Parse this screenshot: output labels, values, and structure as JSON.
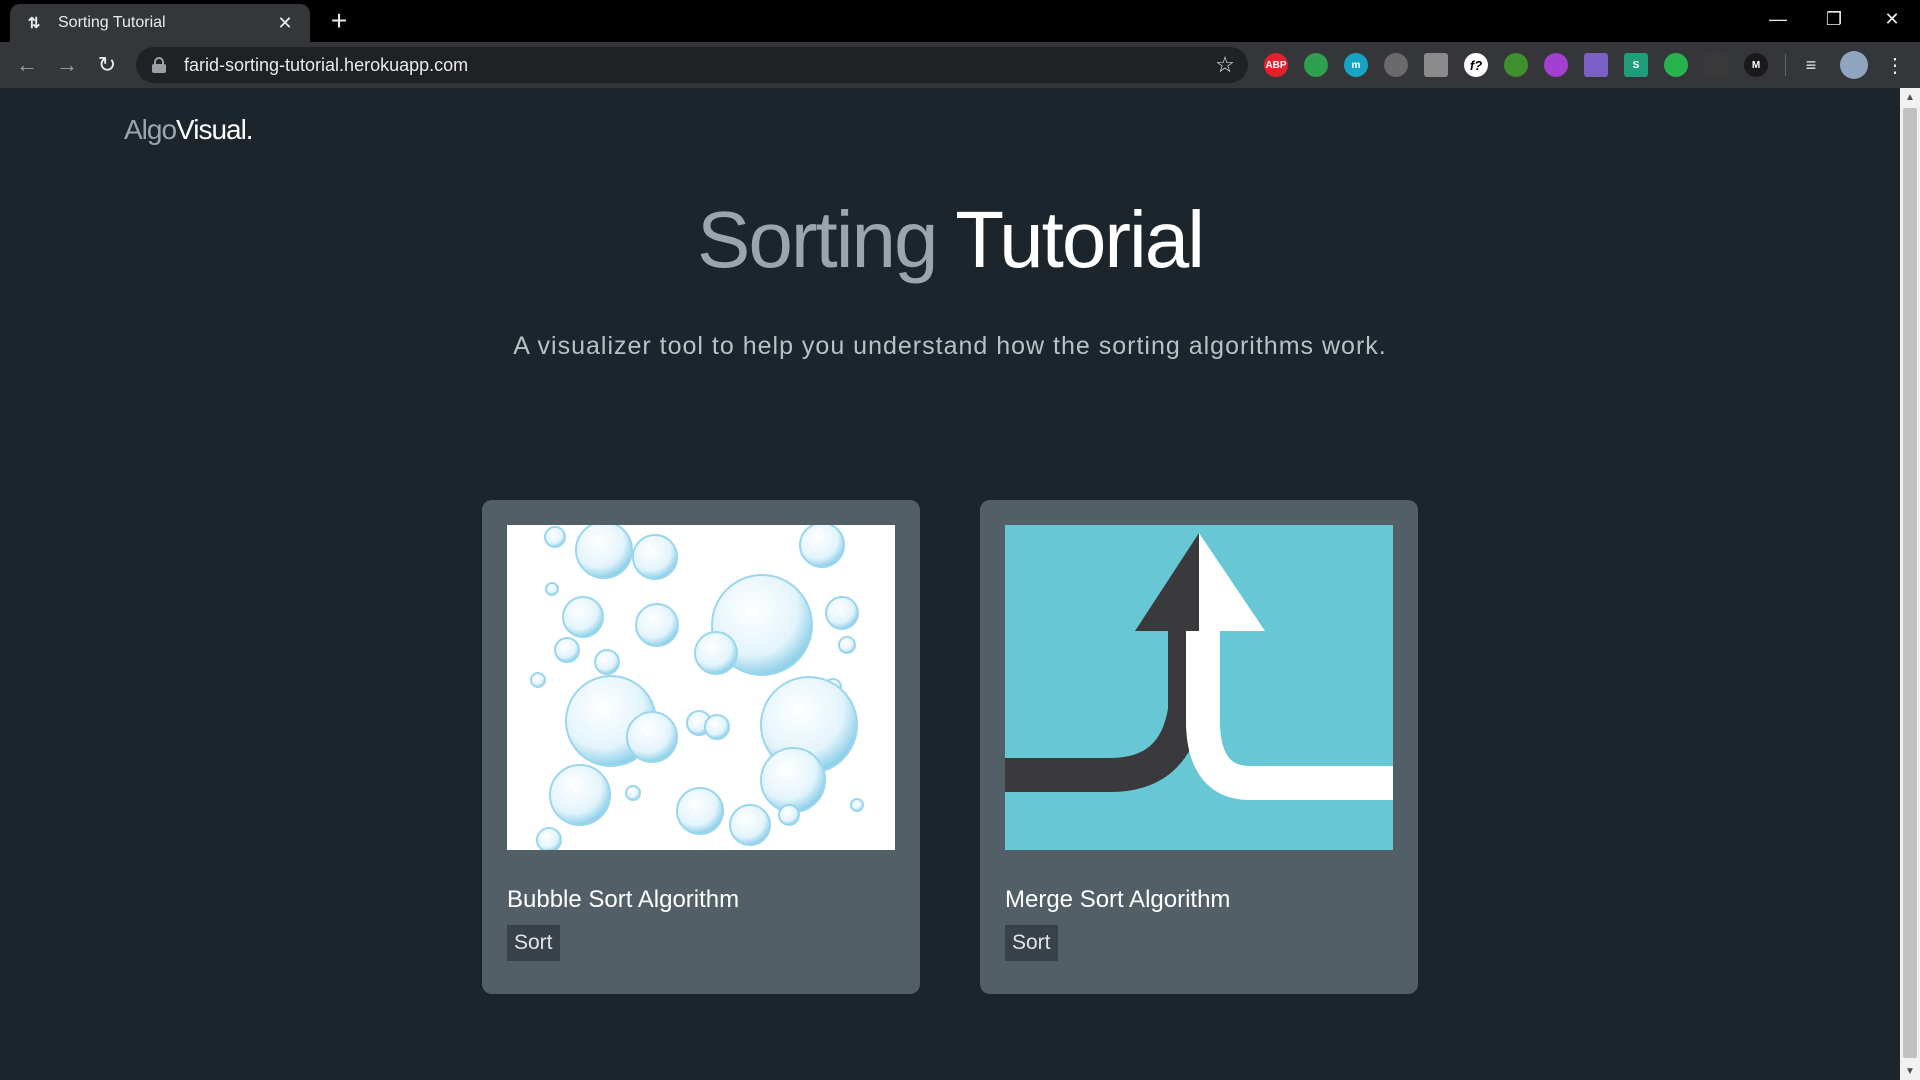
{
  "browser": {
    "tab_title": "Sorting Tutorial",
    "url": "farid-sorting-tutorial.herokuapp.com",
    "extensions": [
      {
        "name": "adblock-plus-extension",
        "label": "ABP",
        "color": "#e6202b"
      },
      {
        "name": "colorful-extension",
        "label": "",
        "color": "#2e9e4f"
      },
      {
        "name": "m-extension",
        "label": "m",
        "color": "#17a4c4"
      },
      {
        "name": "grey-extension",
        "label": "",
        "color": "#6a6a6a"
      },
      {
        "name": "pen-extension",
        "label": "",
        "color": "#8a8a8a"
      },
      {
        "name": "formula-extension",
        "label": "f?",
        "color": "#ffffff"
      },
      {
        "name": "tree-extension",
        "label": "",
        "color": "#3f8f2f"
      },
      {
        "name": "purple-extension",
        "label": "",
        "color": "#a23fd1"
      },
      {
        "name": "pdf-extension",
        "label": "",
        "color": "#7a5fc4"
      },
      {
        "name": "s-extension",
        "label": "S",
        "color": "#1f9c7a"
      },
      {
        "name": "green-m-extension",
        "label": "",
        "color": "#27b34d"
      },
      {
        "name": "grid-extension",
        "label": "",
        "color": "#3a3a3a"
      },
      {
        "name": "dark-extension",
        "label": "M",
        "color": "#1a1a1a"
      }
    ]
  },
  "site": {
    "logo_part1": "Algo",
    "logo_part2": "Visual."
  },
  "hero": {
    "title_part1": "Sorting",
    "title_part2": " Tutorial",
    "subtitle": "A visualizer tool to help you understand how the sorting algorithms work."
  },
  "cards": [
    {
      "title": "Bubble Sort Algorithm",
      "button": "Sort"
    },
    {
      "title": "Merge Sort Algorithm",
      "button": "Sort"
    }
  ],
  "colors": {
    "page_bg": "#1c252b",
    "card_bg": "#535f67",
    "merge_bg": "#67c7d4",
    "arrow_dark": "#3a3a3c"
  }
}
